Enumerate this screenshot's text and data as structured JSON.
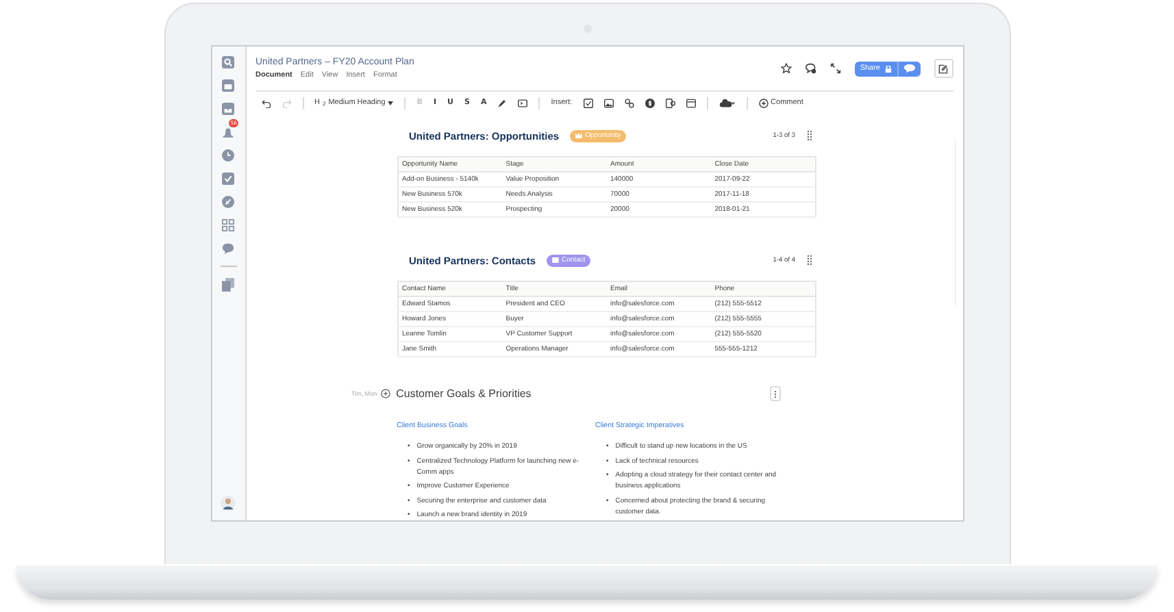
{
  "sidebar": {
    "items": [
      {
        "kind": "search"
      },
      {
        "kind": "calendar"
      },
      {
        "kind": "inbox"
      },
      {
        "kind": "bell",
        "badge": "56"
      },
      {
        "kind": "clock"
      },
      {
        "kind": "check"
      },
      {
        "kind": "stamp"
      },
      {
        "kind": "grid"
      },
      {
        "kind": "chat"
      },
      {
        "kind": "divider"
      },
      {
        "kind": "docs"
      }
    ]
  },
  "document": {
    "title": "United Partners – FY20 Account Plan",
    "menu": [
      {
        "label": "Document",
        "selected": true
      },
      {
        "label": "Edit",
        "selected": false
      },
      {
        "label": "View",
        "selected": false
      },
      {
        "label": "Insert",
        "selected": false
      },
      {
        "label": "Format",
        "selected": false
      }
    ]
  },
  "actions": {
    "share_label": "Share"
  },
  "toolbar": {
    "tools": [
      {
        "kind": "undo",
        "disabled": false
      },
      {
        "kind": "redo",
        "disabled": true
      },
      {
        "kind": "sep"
      },
      {
        "kind": "heading",
        "label": "H$_{2}$",
        "value": "Medium Heading",
        "disabled": false
      },
      {
        "kind": "sep"
      },
      {
        "kind": "text",
        "label": "B",
        "disabled": true
      },
      {
        "kind": "text",
        "label": "I",
        "disabled": false
      },
      {
        "kind": "text",
        "label": "U",
        "disabled": false
      },
      {
        "kind": "text",
        "label": "S",
        "disabled": false
      },
      {
        "kind": "text",
        "label": "A",
        "disabled": false
      },
      {
        "kind": "pen",
        "disabled": false
      },
      {
        "kind": "code",
        "disabled": false
      },
      {
        "kind": "sep"
      },
      {
        "kind": "label",
        "label": "Insert:"
      },
      {
        "kind": "checkbox",
        "disabled": false
      },
      {
        "kind": "image",
        "disabled": false
      },
      {
        "kind": "link",
        "disabled": false
      },
      {
        "kind": "coin",
        "disabled": false
      },
      {
        "kind": "embed",
        "disabled": false
      },
      {
        "kind": "window",
        "disabled": false
      },
      {
        "kind": "sep"
      },
      {
        "kind": "cloud",
        "disabled": false
      },
      {
        "kind": "sep"
      },
      {
        "kind": "comment",
        "label": "Comment",
        "disabled": false
      }
    ]
  },
  "sections": [
    {
      "title": "United Partners: Opportunities",
      "badge": {
        "label": "Opportunity",
        "kind": "crown",
        "color": "#f4bc6a"
      },
      "count": "1-3 of 3",
      "columns": [
        "Opportunity Name",
        "Stage",
        "Amount",
        "Close Date"
      ],
      "rows": [
        [
          "Add-on Business - 5140k",
          "Value Proposition",
          "140000",
          "2017-09-22"
        ],
        [
          "New Business 570k",
          "Needs Analysis",
          "70000",
          "2017-11-18"
        ],
        [
          "New Business 520k",
          "Prospecting",
          "20000",
          "2018-01-21"
        ]
      ]
    },
    {
      "title": "United Partners: Contacts",
      "badge": {
        "label": "Contact",
        "kind": "card",
        "color": "#a094ed"
      },
      "count": "1-4 of 4",
      "columns": [
        "Contact Name",
        "Title",
        "Email",
        "Phone"
      ],
      "rows": [
        [
          "Edward Stamos",
          "President and CEO",
          "info@salesforce.com",
          "(212) 555-5512"
        ],
        [
          "Howard Jones",
          "Buyer",
          "info@salesforce.com",
          "(212) 555-5555"
        ],
        [
          "Leanne Tomlin",
          "VP Customer Support",
          "info@salesforce.com",
          "(212) 555-5520"
        ],
        [
          "Jane Smith",
          "Operations Manager",
          "info@salesforce.com",
          "555-555-1212"
        ]
      ]
    }
  ],
  "goals": {
    "meta": "Tim, Mon",
    "bullet": "•",
    "title": "Customer Goals & Priorities",
    "columns": [
      {
        "heading": "Client Business Goals",
        "items": [
          "Grow organically by 20% in 2019",
          "Centralized Technology Platform for launching new e-Comm apps",
          "Improve Customer Experience",
          "Securing the enterprise and customer data",
          "Launch a new brand identity in 2019"
        ]
      },
      {
        "heading": "Client Strategic Imperatives",
        "items": [
          "Difficult to stand up new locations in the US",
          "Lack of technical resources",
          "Adopting a cloud strategy for their contact center and business applications",
          "Concerned about protecting the brand & securing customer data."
        ]
      }
    ]
  }
}
